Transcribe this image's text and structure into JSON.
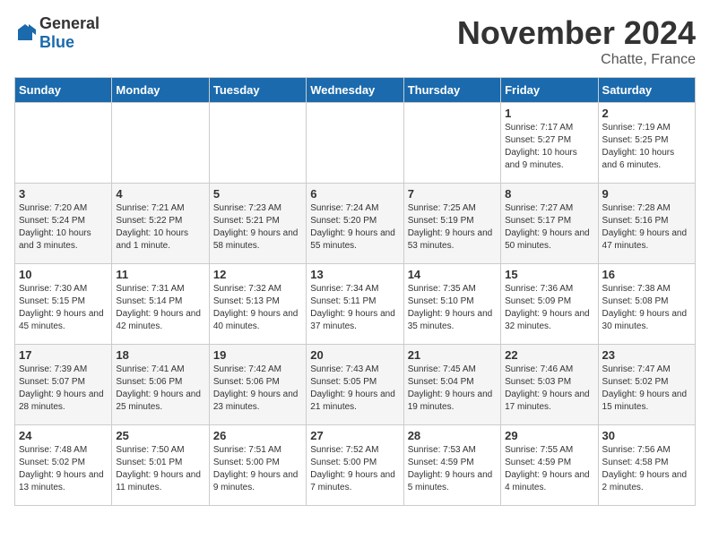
{
  "header": {
    "logo_general": "General",
    "logo_blue": "Blue",
    "month_title": "November 2024",
    "location": "Chatte, France"
  },
  "weekdays": [
    "Sunday",
    "Monday",
    "Tuesday",
    "Wednesday",
    "Thursday",
    "Friday",
    "Saturday"
  ],
  "weeks": [
    [
      {
        "day": "",
        "info": ""
      },
      {
        "day": "",
        "info": ""
      },
      {
        "day": "",
        "info": ""
      },
      {
        "day": "",
        "info": ""
      },
      {
        "day": "",
        "info": ""
      },
      {
        "day": "1",
        "info": "Sunrise: 7:17 AM\nSunset: 5:27 PM\nDaylight: 10 hours and 9 minutes."
      },
      {
        "day": "2",
        "info": "Sunrise: 7:19 AM\nSunset: 5:25 PM\nDaylight: 10 hours and 6 minutes."
      }
    ],
    [
      {
        "day": "3",
        "info": "Sunrise: 7:20 AM\nSunset: 5:24 PM\nDaylight: 10 hours and 3 minutes."
      },
      {
        "day": "4",
        "info": "Sunrise: 7:21 AM\nSunset: 5:22 PM\nDaylight: 10 hours and 1 minute."
      },
      {
        "day": "5",
        "info": "Sunrise: 7:23 AM\nSunset: 5:21 PM\nDaylight: 9 hours and 58 minutes."
      },
      {
        "day": "6",
        "info": "Sunrise: 7:24 AM\nSunset: 5:20 PM\nDaylight: 9 hours and 55 minutes."
      },
      {
        "day": "7",
        "info": "Sunrise: 7:25 AM\nSunset: 5:19 PM\nDaylight: 9 hours and 53 minutes."
      },
      {
        "day": "8",
        "info": "Sunrise: 7:27 AM\nSunset: 5:17 PM\nDaylight: 9 hours and 50 minutes."
      },
      {
        "day": "9",
        "info": "Sunrise: 7:28 AM\nSunset: 5:16 PM\nDaylight: 9 hours and 47 minutes."
      }
    ],
    [
      {
        "day": "10",
        "info": "Sunrise: 7:30 AM\nSunset: 5:15 PM\nDaylight: 9 hours and 45 minutes."
      },
      {
        "day": "11",
        "info": "Sunrise: 7:31 AM\nSunset: 5:14 PM\nDaylight: 9 hours and 42 minutes."
      },
      {
        "day": "12",
        "info": "Sunrise: 7:32 AM\nSunset: 5:13 PM\nDaylight: 9 hours and 40 minutes."
      },
      {
        "day": "13",
        "info": "Sunrise: 7:34 AM\nSunset: 5:11 PM\nDaylight: 9 hours and 37 minutes."
      },
      {
        "day": "14",
        "info": "Sunrise: 7:35 AM\nSunset: 5:10 PM\nDaylight: 9 hours and 35 minutes."
      },
      {
        "day": "15",
        "info": "Sunrise: 7:36 AM\nSunset: 5:09 PM\nDaylight: 9 hours and 32 minutes."
      },
      {
        "day": "16",
        "info": "Sunrise: 7:38 AM\nSunset: 5:08 PM\nDaylight: 9 hours and 30 minutes."
      }
    ],
    [
      {
        "day": "17",
        "info": "Sunrise: 7:39 AM\nSunset: 5:07 PM\nDaylight: 9 hours and 28 minutes."
      },
      {
        "day": "18",
        "info": "Sunrise: 7:41 AM\nSunset: 5:06 PM\nDaylight: 9 hours and 25 minutes."
      },
      {
        "day": "19",
        "info": "Sunrise: 7:42 AM\nSunset: 5:06 PM\nDaylight: 9 hours and 23 minutes."
      },
      {
        "day": "20",
        "info": "Sunrise: 7:43 AM\nSunset: 5:05 PM\nDaylight: 9 hours and 21 minutes."
      },
      {
        "day": "21",
        "info": "Sunrise: 7:45 AM\nSunset: 5:04 PM\nDaylight: 9 hours and 19 minutes."
      },
      {
        "day": "22",
        "info": "Sunrise: 7:46 AM\nSunset: 5:03 PM\nDaylight: 9 hours and 17 minutes."
      },
      {
        "day": "23",
        "info": "Sunrise: 7:47 AM\nSunset: 5:02 PM\nDaylight: 9 hours and 15 minutes."
      }
    ],
    [
      {
        "day": "24",
        "info": "Sunrise: 7:48 AM\nSunset: 5:02 PM\nDaylight: 9 hours and 13 minutes."
      },
      {
        "day": "25",
        "info": "Sunrise: 7:50 AM\nSunset: 5:01 PM\nDaylight: 9 hours and 11 minutes."
      },
      {
        "day": "26",
        "info": "Sunrise: 7:51 AM\nSunset: 5:00 PM\nDaylight: 9 hours and 9 minutes."
      },
      {
        "day": "27",
        "info": "Sunrise: 7:52 AM\nSunset: 5:00 PM\nDaylight: 9 hours and 7 minutes."
      },
      {
        "day": "28",
        "info": "Sunrise: 7:53 AM\nSunset: 4:59 PM\nDaylight: 9 hours and 5 minutes."
      },
      {
        "day": "29",
        "info": "Sunrise: 7:55 AM\nSunset: 4:59 PM\nDaylight: 9 hours and 4 minutes."
      },
      {
        "day": "30",
        "info": "Sunrise: 7:56 AM\nSunset: 4:58 PM\nDaylight: 9 hours and 2 minutes."
      }
    ]
  ]
}
